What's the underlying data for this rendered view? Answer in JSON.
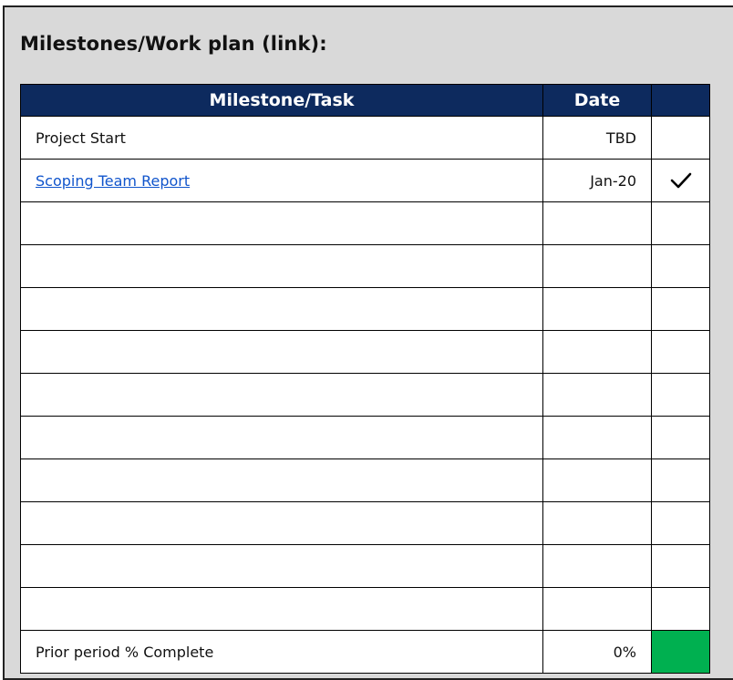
{
  "heading": "Milestones/Work plan (link):",
  "table": {
    "headers": [
      "Milestone/Task",
      "Date",
      ""
    ],
    "rows": [
      {
        "task": "Project Start",
        "date": "TBD",
        "done": false,
        "link": false
      },
      {
        "task": "Scoping Team Report",
        "date": "Jan-20",
        "done": true,
        "link": true
      },
      {
        "task": "",
        "date": "",
        "done": false,
        "link": false
      },
      {
        "task": "",
        "date": "",
        "done": false,
        "link": false
      },
      {
        "task": "",
        "date": "",
        "done": false,
        "link": false
      },
      {
        "task": "",
        "date": "",
        "done": false,
        "link": false
      },
      {
        "task": "",
        "date": "",
        "done": false,
        "link": false
      },
      {
        "task": "",
        "date": "",
        "done": false,
        "link": false
      },
      {
        "task": "",
        "date": "",
        "done": false,
        "link": false
      },
      {
        "task": "",
        "date": "",
        "done": false,
        "link": false
      },
      {
        "task": "",
        "date": "",
        "done": false,
        "link": false
      },
      {
        "task": "",
        "date": "",
        "done": false,
        "link": false
      }
    ],
    "footer": {
      "label": "Prior period % Complete",
      "value": "0%",
      "status_color": "#00b050"
    }
  },
  "colors": {
    "header_bg": "#0d2a5e",
    "panel_bg": "#d9d9d9",
    "link": "#1155cc"
  },
  "icons": {
    "done": "checkmark-icon"
  }
}
